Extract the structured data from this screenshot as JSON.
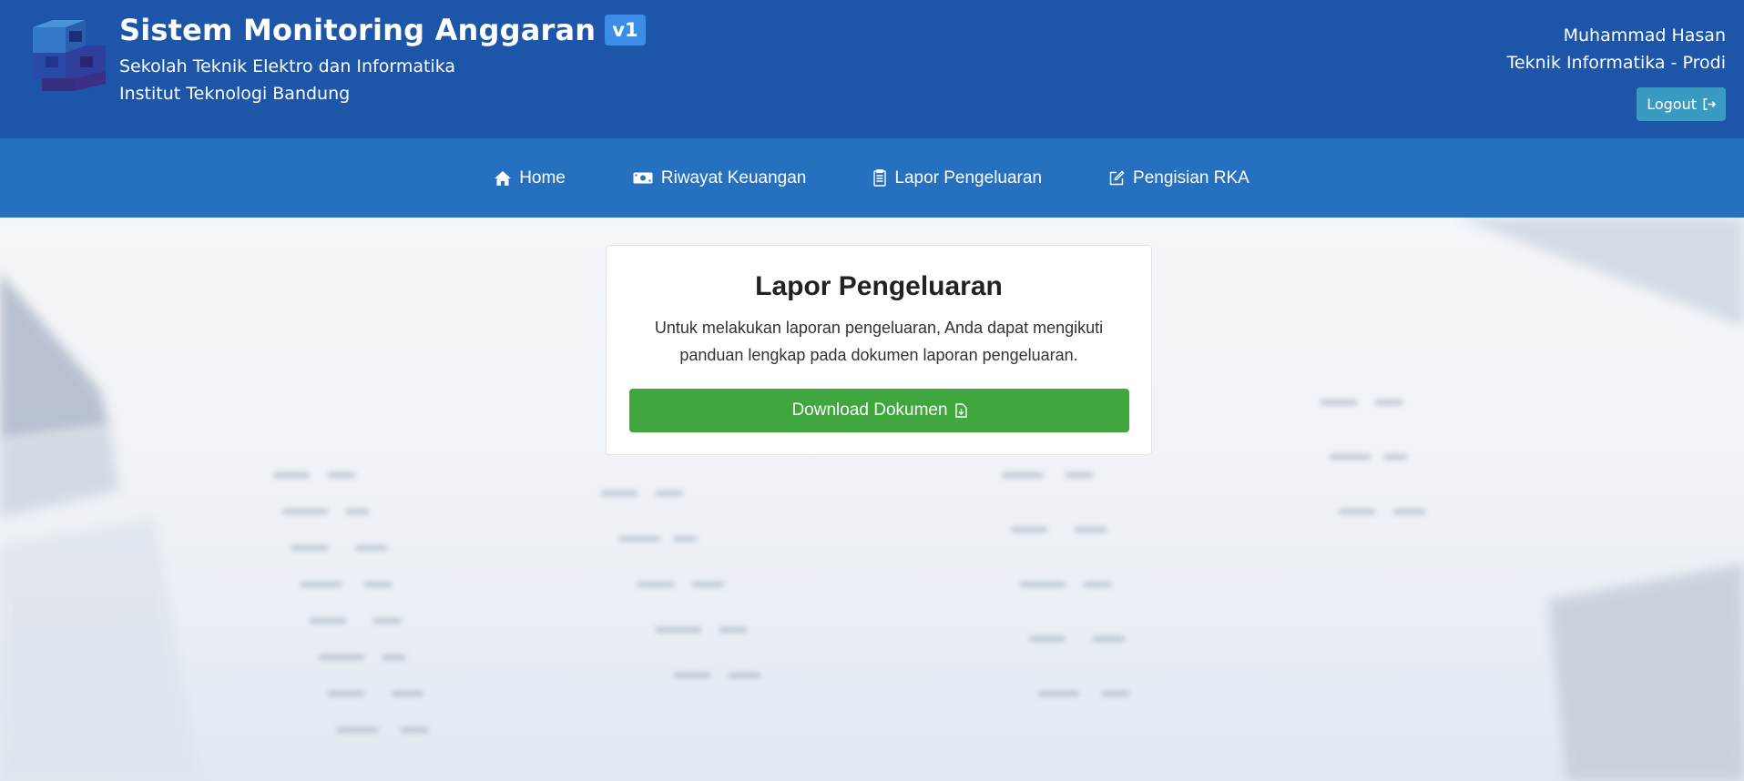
{
  "header": {
    "title": "Sistem Monitoring Anggaran",
    "version": "v1",
    "subtitle_1": "Sekolah Teknik Elektro dan Informatika",
    "subtitle_2": "Institut Teknologi Bandung",
    "logo_icon": "cube-s-logo-icon",
    "user_name": "Muhammad Hasan",
    "user_department": "Teknik Informatika - Prodi",
    "logout_label": "Logout",
    "colors": {
      "header_bg": "#1d56a8",
      "badge_bg": "#3b8de8",
      "logout_bg": "#3a9bc2"
    }
  },
  "nav": {
    "items": [
      {
        "label": "Home",
        "icon": "home-icon"
      },
      {
        "label": "Riwayat Keuangan",
        "icon": "money-icon"
      },
      {
        "label": "Lapor Pengeluaran",
        "icon": "clipboard-icon"
      },
      {
        "label": "Pengisian RKA",
        "icon": "edit-icon"
      }
    ],
    "bg_color": "#2670c0"
  },
  "card": {
    "title": "Lapor Pengeluaran",
    "text": "Untuk melakukan laporan pengeluaran, Anda dapat mengikuti panduan lengkap pada dokumen laporan pengeluaran.",
    "button_label": "Download Dokumen",
    "button_icon": "file-download-icon",
    "button_color": "#3fa73d"
  }
}
